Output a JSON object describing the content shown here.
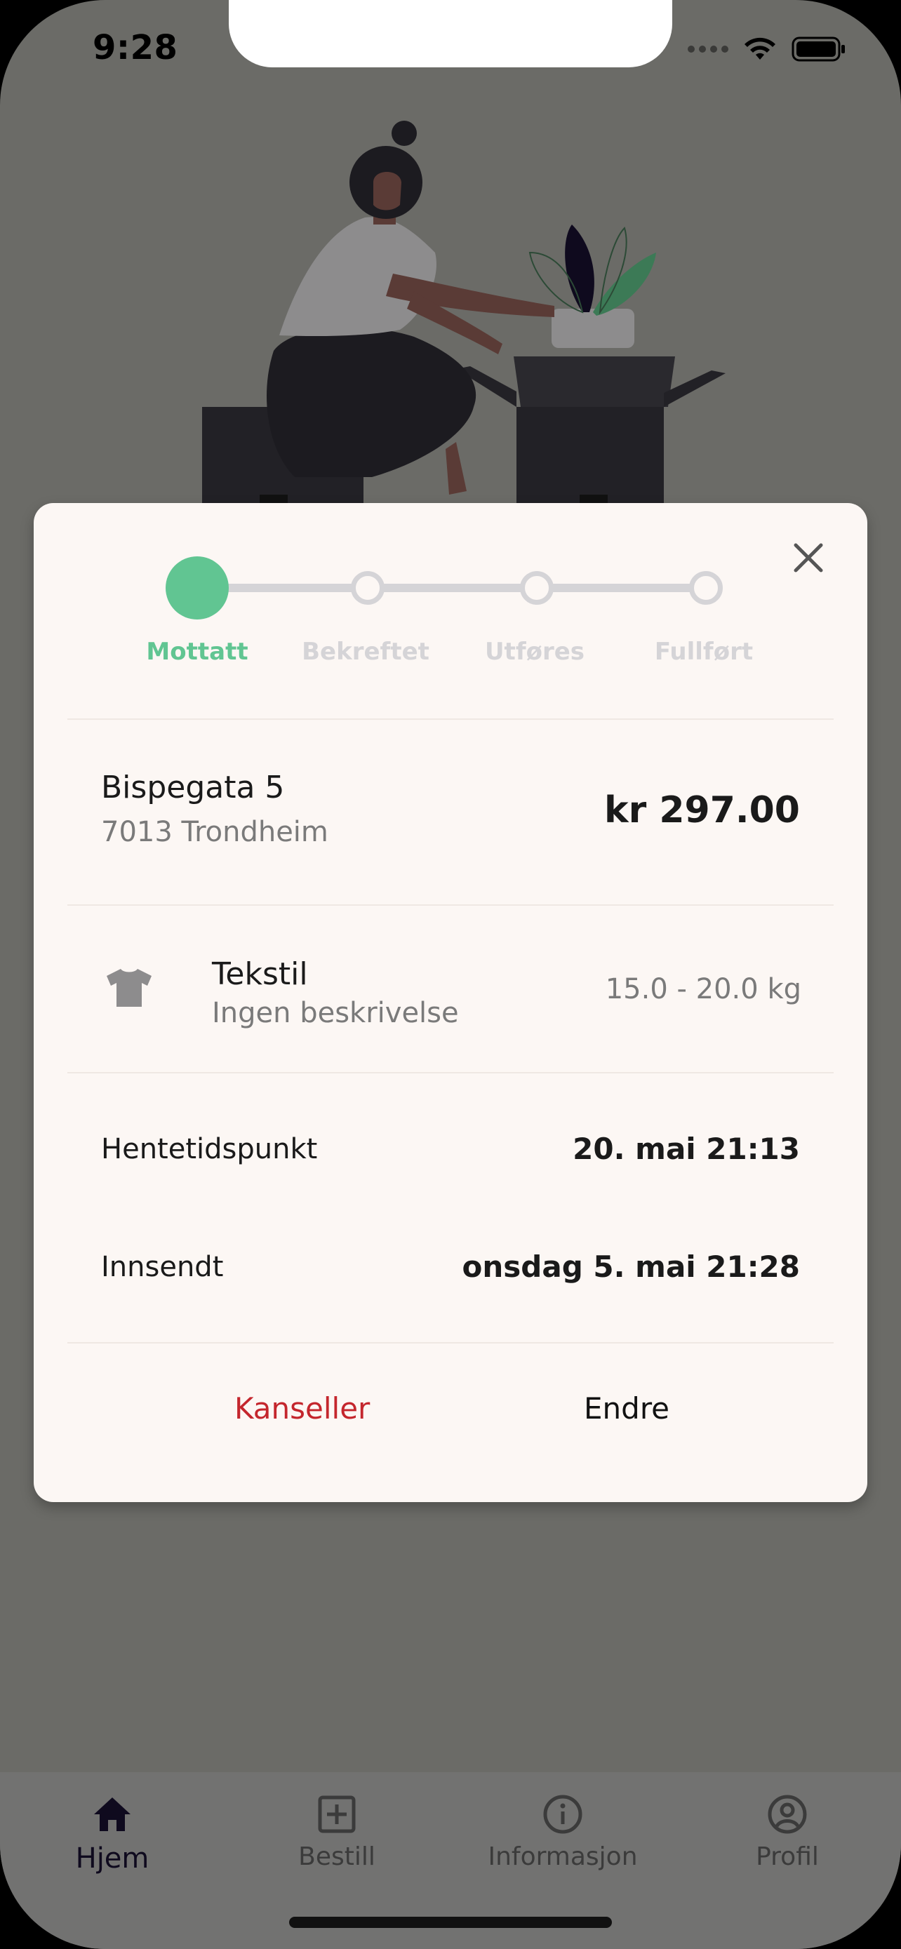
{
  "status_bar": {
    "time": "9:28"
  },
  "order": {
    "steps": [
      {
        "label": "Mottatt",
        "active": true
      },
      {
        "label": "Bekreftet",
        "active": false
      },
      {
        "label": "Utføres",
        "active": false
      },
      {
        "label": "Fullført",
        "active": false
      }
    ],
    "address": {
      "street": "Bispegata 5",
      "city": "7013 Trondheim"
    },
    "price": "kr 297.00",
    "item": {
      "icon": "tshirt-icon",
      "name": "Tekstil",
      "description": "Ingen beskrivelse",
      "weight": "15.0 - 20.0 kg"
    },
    "pickup": {
      "label": "Hentetidspunkt",
      "value": "20. mai 21:13"
    },
    "submitted": {
      "label": "Innsendt",
      "value": "onsdag 5. mai 21:28"
    },
    "actions": {
      "cancel_label": "Kanseller",
      "edit_label": "Endre"
    }
  },
  "tabbar": {
    "items": [
      {
        "label": "Hjem",
        "icon": "home-icon",
        "active": true
      },
      {
        "label": "Bestill",
        "icon": "plus-square-icon",
        "active": false
      },
      {
        "label": "Informasjon",
        "icon": "info-icon",
        "active": false
      },
      {
        "label": "Profil",
        "icon": "profile-icon",
        "active": false
      }
    ]
  },
  "colors": {
    "accent": "#61c592",
    "danger": "#c4262d",
    "inactive_step": "#d5d4d7",
    "card_bg": "#fcf7f4",
    "overlay_bg": "#6b6b67"
  }
}
